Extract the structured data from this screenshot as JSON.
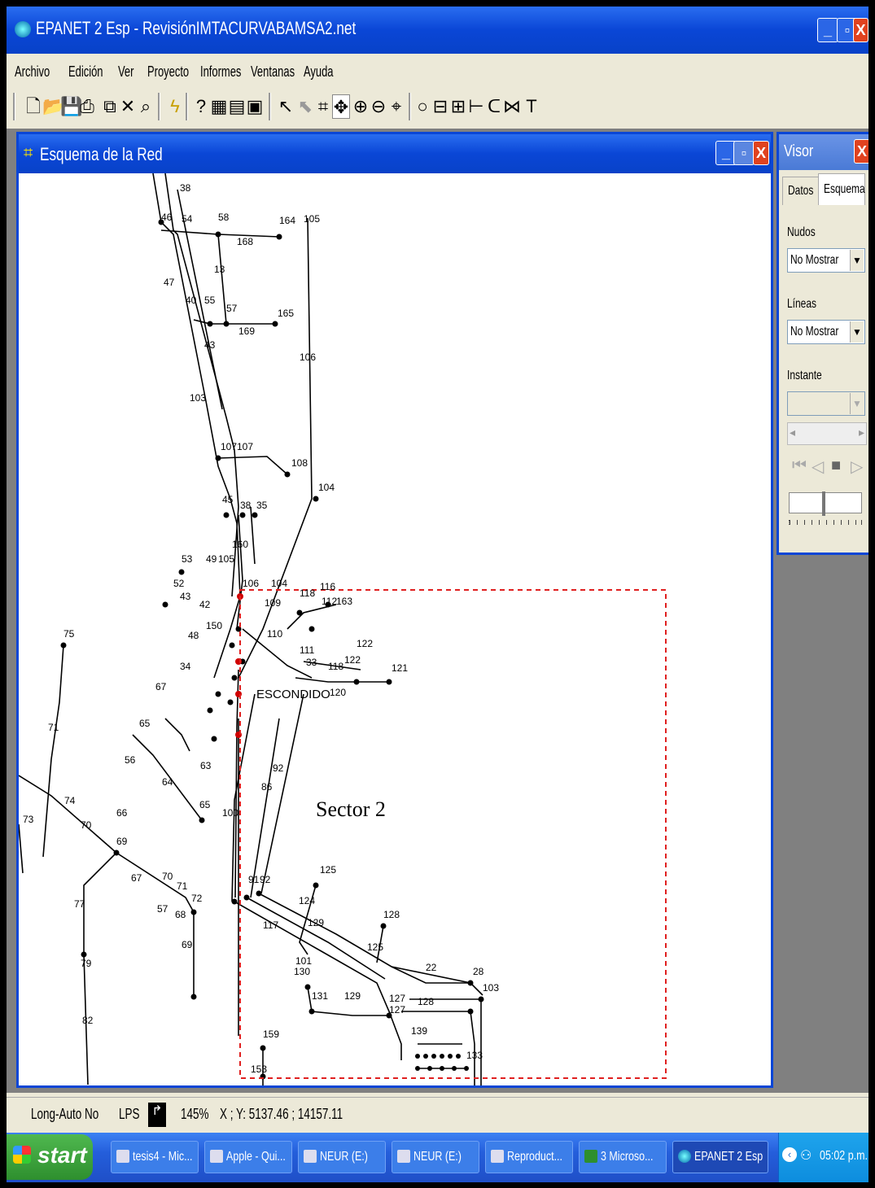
{
  "app": {
    "title": "EPANET 2 Esp - RevisiónIMTACURVABAMSA2.net",
    "window_buttons": [
      "_",
      "▫",
      "X"
    ]
  },
  "menu": [
    "Archivo",
    "Edición",
    "Ver",
    "Proyecto",
    "Informes",
    "Ventanas",
    "Ayuda"
  ],
  "child_window": {
    "title": "Esquema de la Red",
    "sector_label": "Sector 2",
    "labels": [
      "105",
      "38",
      "46",
      "54",
      "53",
      "58",
      "164",
      "168",
      "13",
      "47",
      "40",
      "55",
      "57",
      "165",
      "169",
      "43",
      "106",
      "103",
      "107",
      "107",
      "108",
      "104",
      "45",
      "38",
      "35",
      "160",
      "53",
      "49",
      "105",
      "52",
      "43",
      "42",
      "106",
      "104",
      "118",
      "116",
      "112",
      "163",
      "109",
      "75",
      "48",
      "150",
      "110",
      "122",
      "111",
      "33",
      "118",
      "122",
      "121",
      "34",
      "120",
      "67",
      "ESCONDIDO",
      "71",
      "65",
      "56",
      "63",
      "64",
      "92",
      "86",
      "73",
      "74",
      "70",
      "66",
      "65",
      "100",
      "69",
      "125",
      "67",
      "70",
      "71",
      "72",
      "77",
      "57",
      "68",
      "91",
      "92",
      "124",
      "128",
      "117",
      "69",
      "129",
      "125",
      "79",
      "101",
      "130",
      "127",
      "22",
      "28",
      "103",
      "131",
      "129",
      "127",
      "128",
      "82",
      "159",
      "139",
      "133",
      "153"
    ]
  },
  "visor": {
    "title": "Visor",
    "tabs": [
      "Datos",
      "Esquema"
    ],
    "nudos_label": "Nudos",
    "nudos_value": "No Mostrar",
    "lineas_label": "Líneas",
    "lineas_value": "No Mostrar",
    "instante_label": "Instante"
  },
  "status": {
    "long_auto": "Long-Auto No",
    "units": "LPS",
    "zoom": "145%",
    "xy": "X ; Y: 5137.46 ; 14157.11"
  },
  "taskbar": {
    "start": "start",
    "tasks": [
      "tesis4 - Mic...",
      "Apple - Qui...",
      "NEUR (E:)",
      "NEUR (E:)",
      "Reproduct...",
      "3 Microso...",
      "EPANET 2 Esp"
    ],
    "clock": "05:02 p.m."
  },
  "colors": {
    "titlebar": "#0a46d6",
    "sector_box": "#e02020"
  }
}
